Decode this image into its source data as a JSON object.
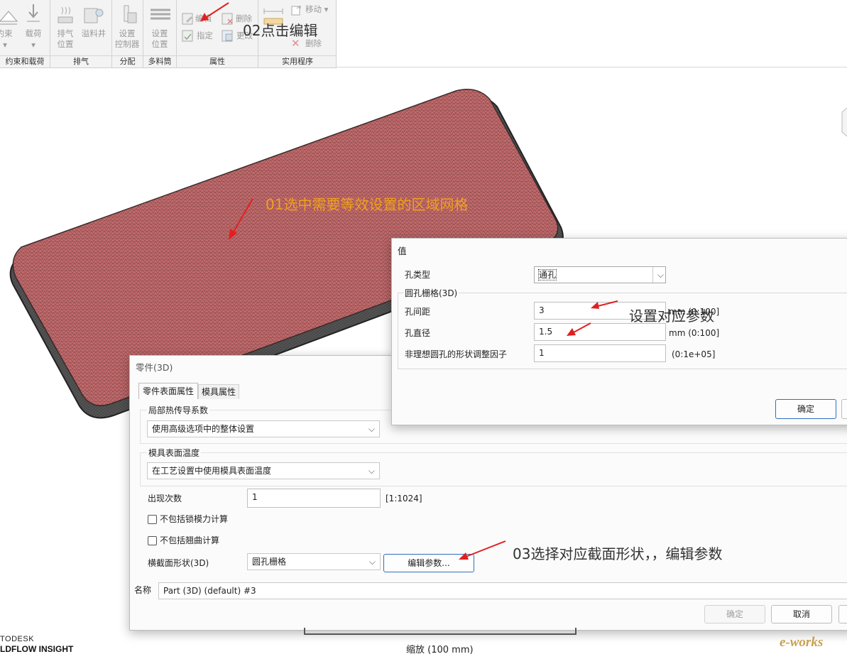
{
  "ribbon": {
    "groups": [
      {
        "buttons": [
          "约束",
          "载荷"
        ],
        "label": "约束和载荷"
      },
      {
        "buttons": [
          "排气位置",
          "溢料井"
        ],
        "label": "排气"
      },
      {
        "buttons": [
          "设置控制器"
        ],
        "label": "分配"
      },
      {
        "buttons": [
          "设置位置"
        ],
        "label": "多料筒"
      },
      {
        "buttons": [
          "编辑",
          "删除",
          "指定",
          "更改"
        ],
        "label": "属性"
      },
      {
        "buttons": [
          "移动",
          "删除"
        ],
        "label": "实用程序"
      }
    ]
  },
  "annotations": {
    "a01": "01选中需要等效设置的区域网格",
    "a02": "02点击编辑",
    "a03": "03选择对应截面形状，，编辑参数",
    "a04": "设置对应参数"
  },
  "value_dialog": {
    "title": "值",
    "hole_type_label": "孔类型",
    "hole_type_value": "通孔",
    "group_label": "圆孔栅格(3D)",
    "rows": [
      {
        "label": "孔间距",
        "value": "3",
        "range": "mm (0:100]"
      },
      {
        "label": "孔直径",
        "value": "1.5",
        "range": "mm (0:100]"
      },
      {
        "label": "非理想圆孔的形状调整因子",
        "value": "1",
        "range": "(0:1e+05]"
      }
    ],
    "ok_label": "确定"
  },
  "part_dialog": {
    "title": "零件(3D)",
    "tabs": [
      "零件表面属性",
      "模具属性"
    ],
    "heat_group": "局部热传导系数",
    "heat_value": "使用高级选项中的整体设置",
    "mold_temp_group": "模具表面温度",
    "mold_temp_value": "在工艺设置中使用模具表面温度",
    "occurrence_label": "出现次数",
    "occurrence_value": "1",
    "occurrence_range": "[1:1024]",
    "exclude_clamp": "不包括锁模力计算",
    "exclude_warp": "不包括翘曲计算",
    "cross_section_label": "横截面形状(3D)",
    "cross_section_value": "圆孔栅格",
    "edit_params_button": "编辑参数...",
    "name_label": "名称",
    "name_value": "Part (3D) (default) #3",
    "ok_label": "确定",
    "cancel_label": "取消"
  },
  "status": {
    "logo_line1": "TODESK",
    "logo_line2": "LDFLOW INSIGHT",
    "scale_label": "缩放 (100 mm)",
    "watermark": "e-works"
  },
  "colors": {
    "mesh_fill": "#c0686a",
    "annotation_orange": "#f0a020",
    "arrow_red": "#e02020",
    "ok_border": "#2f6fbf"
  }
}
